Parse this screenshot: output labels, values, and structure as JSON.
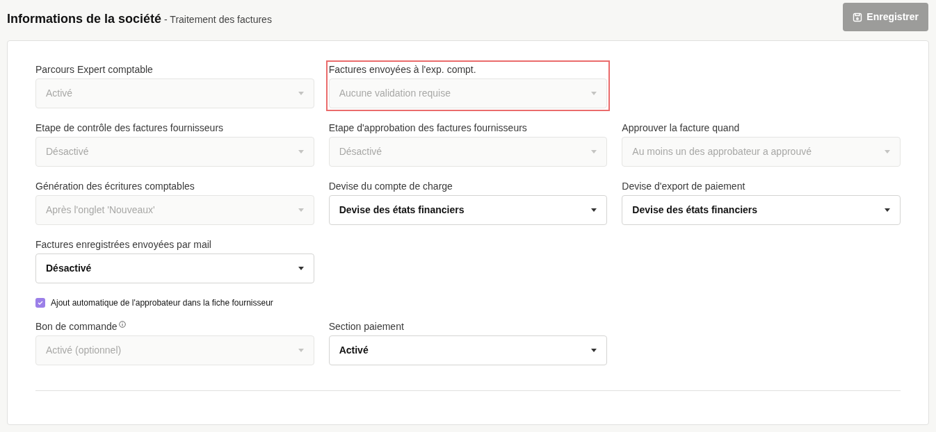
{
  "header": {
    "title": "Informations de la société",
    "subtitle": "- Traitement des factures",
    "save_button": {
      "label": "Enregistrer",
      "disabled": true
    }
  },
  "rows": [
    [
      {
        "label": "Parcours Expert comptable",
        "value": "Activé",
        "disabled": true,
        "highlighted": false
      },
      {
        "label": "Factures envoyées à l'exp. compt.",
        "value": "Aucune validation requise",
        "disabled": true,
        "highlighted": true
      }
    ],
    [
      {
        "label": "Etape de contrôle des factures fournisseurs",
        "value": "Désactivé",
        "disabled": true,
        "highlighted": false
      },
      {
        "label": "Etape d'approbation des factures fournisseurs",
        "value": "Désactivé",
        "disabled": true,
        "highlighted": false
      },
      {
        "label": "Approuver la facture quand",
        "value": "Au moins un des approbateur a approuvé",
        "disabled": true,
        "highlighted": false
      }
    ],
    [
      {
        "label": "Génération des écritures comptables",
        "value": "Après l'onglet 'Nouveaux'",
        "disabled": true,
        "highlighted": false
      },
      {
        "label": "Devise du compte de charge",
        "value": "Devise des états financiers",
        "disabled": false,
        "highlighted": false
      },
      {
        "label": "Devise d'export de paiement",
        "value": "Devise des états financiers",
        "disabled": false,
        "highlighted": false
      }
    ],
    [
      {
        "label": "Factures enregistrées envoyées par mail",
        "value": "Désactivé",
        "disabled": false,
        "highlighted": false
      }
    ]
  ],
  "checkbox": {
    "label": "Ajout automatique de l'approbateur dans la fiche fournisseur",
    "checked": true
  },
  "rows_after": [
    [
      {
        "label": "Bon de commande",
        "info": true,
        "value": "Activé (optionnel)",
        "disabled": true,
        "highlighted": false
      },
      {
        "label": "Section paiement",
        "value": "Activé",
        "disabled": false,
        "highlighted": false
      }
    ]
  ]
}
